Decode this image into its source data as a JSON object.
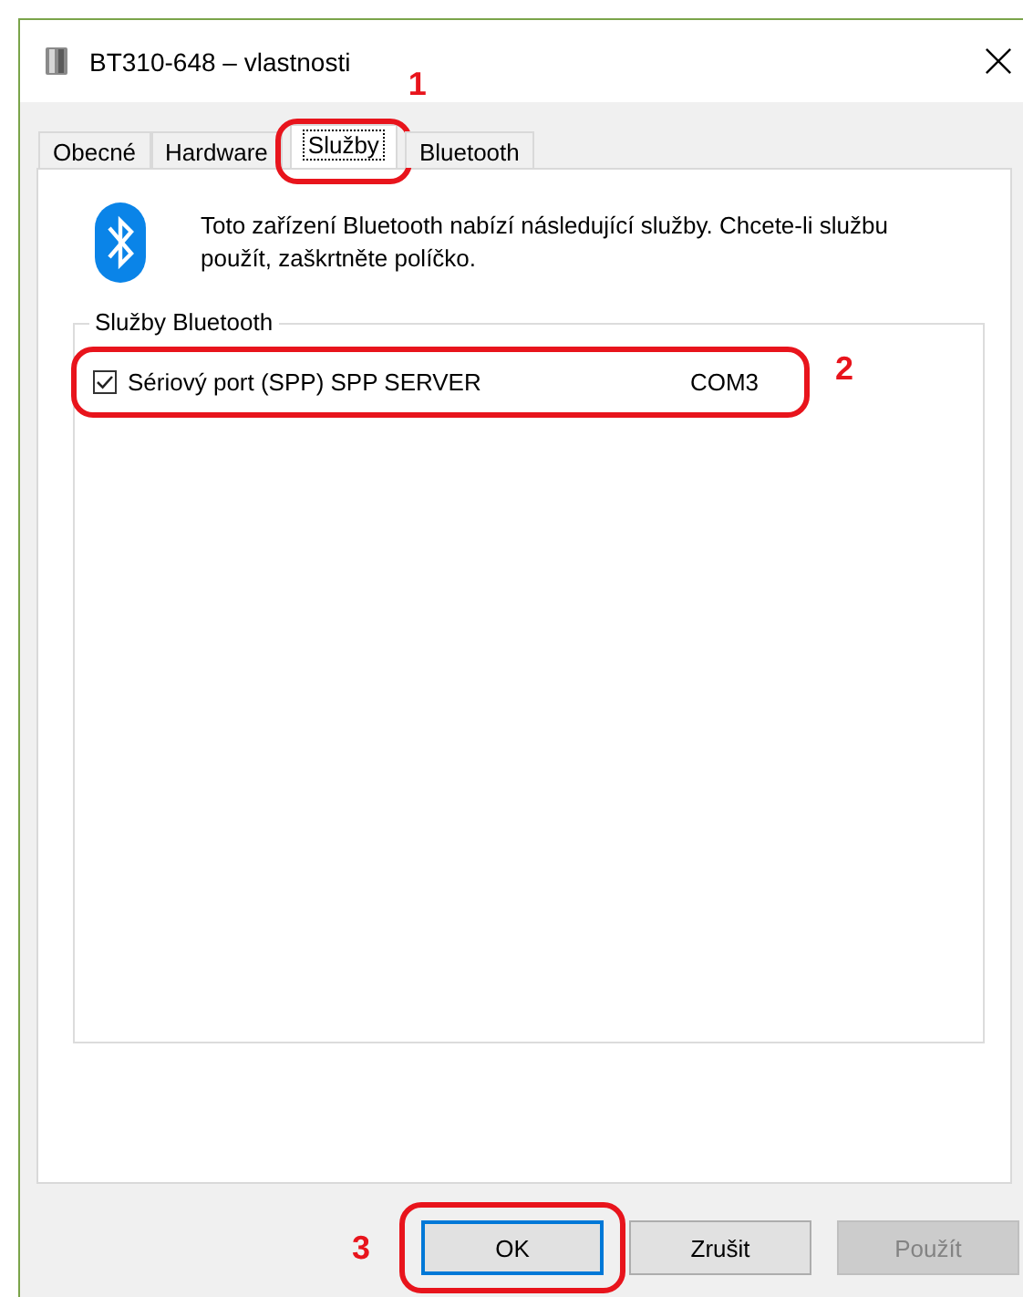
{
  "window": {
    "title": "BT310-648 – vlastnosti"
  },
  "tabs": [
    {
      "label": "Obecné",
      "selected": false
    },
    {
      "label": "Hardware",
      "selected": false
    },
    {
      "label": "Služby",
      "selected": true,
      "annotation": "1"
    },
    {
      "label": "Bluetooth",
      "selected": false
    }
  ],
  "description": "Toto zařízení Bluetooth nabízí následující služby. Chcete-li službu použít, zaškrtněte políčko.",
  "group": {
    "title": "Služby Bluetooth"
  },
  "services": [
    {
      "name": "Sériový port (SPP) SPP SERVER",
      "port": "COM3",
      "checked": true,
      "annotation": "2"
    }
  ],
  "buttons": [
    {
      "label": "OK",
      "kind": "default",
      "annotation": "3"
    },
    {
      "label": "Zrušit",
      "kind": "normal"
    },
    {
      "label": "Použít",
      "kind": "disabled"
    }
  ]
}
